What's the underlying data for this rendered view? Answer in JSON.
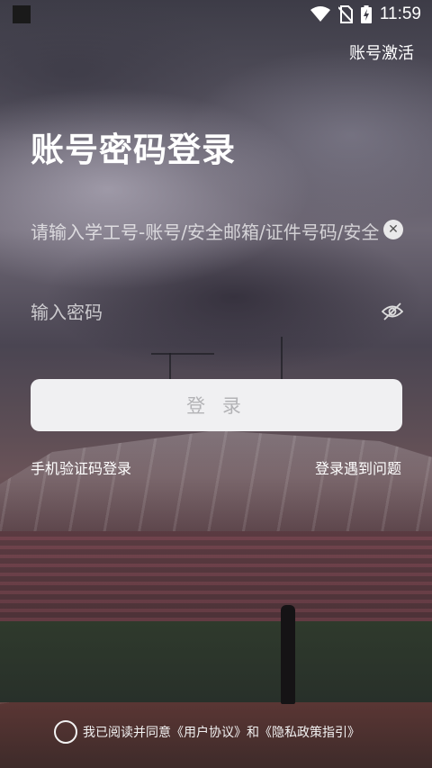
{
  "status_bar": {
    "time": "11:59",
    "icons": [
      "wifi-icon",
      "no-sim-icon",
      "battery-charging-icon"
    ]
  },
  "header": {
    "activate_link": "账号激活"
  },
  "title": "账号密码登录",
  "account_field": {
    "placeholder": "请输入学工号-账号/安全邮箱/证件号码/安全",
    "value": ""
  },
  "password_field": {
    "placeholder": "输入密码",
    "value": ""
  },
  "login_button": "登 录",
  "links": {
    "sms_login": "手机验证码登录",
    "login_help": "登录遇到问题"
  },
  "agreement": {
    "prefix": "我已阅读并同意",
    "user_agreement": "《用户协议》",
    "and": "和",
    "privacy": "《隐私政策指引》",
    "checked": false
  },
  "colors": {
    "button_bg": "#f0f0f2",
    "button_text": "#b3b3b6"
  }
}
